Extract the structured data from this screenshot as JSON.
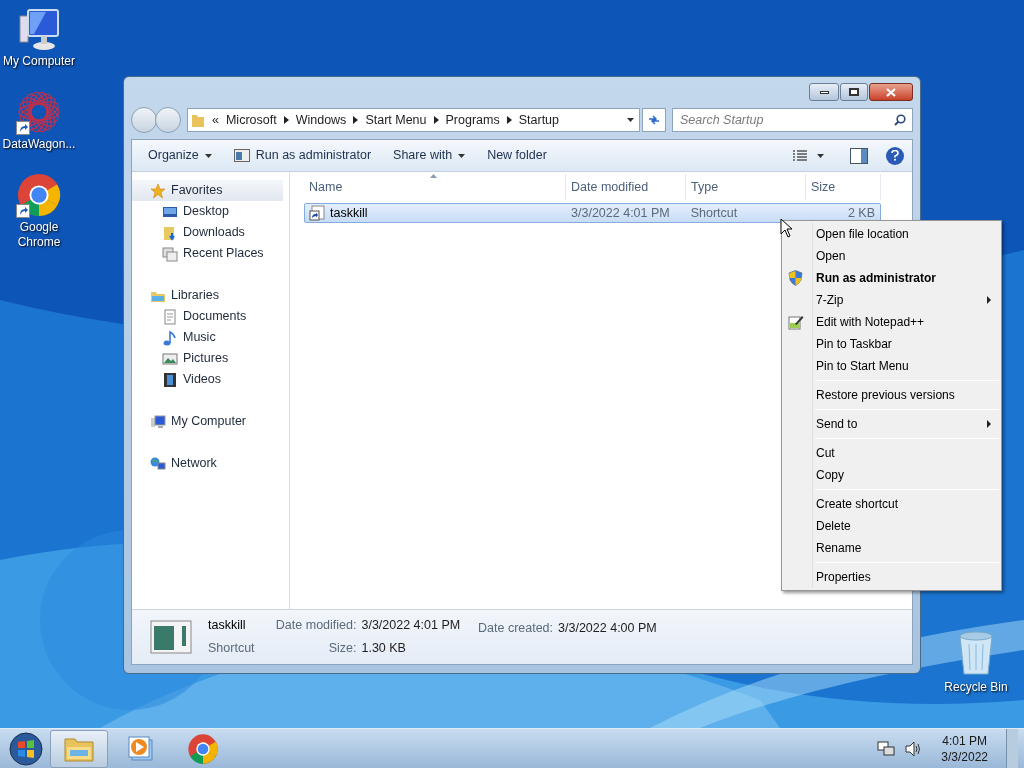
{
  "desktop_icons": [
    {
      "label": "My Computer",
      "kind": "computer"
    },
    {
      "label": "DataWagon...",
      "kind": "datawagon"
    },
    {
      "label": "Google Chrome",
      "kind": "chrome"
    }
  ],
  "recycle_bin": {
    "label": "Recycle Bin"
  },
  "window": {
    "address": {
      "overflow": "«",
      "segments": [
        "Microsoft",
        "Windows",
        "Start Menu",
        "Programs",
        "Startup"
      ]
    },
    "search": {
      "placeholder": "Search Startup"
    },
    "toolbar": [
      {
        "label": "Organize",
        "kind": "menu"
      },
      {
        "label": "Run as administrator",
        "kind": "icon"
      },
      {
        "label": "Share with",
        "kind": "menu"
      },
      {
        "label": "New folder",
        "kind": "plain"
      }
    ],
    "nav": [
      {
        "label": "Favorites",
        "kind": "star",
        "selected": true,
        "children": [
          {
            "label": "Desktop",
            "kind": "desktop",
            "selected": false
          },
          {
            "label": "Downloads",
            "kind": "downloads",
            "selected": false
          },
          {
            "label": "Recent Places",
            "kind": "recent",
            "selected": false
          }
        ]
      },
      {
        "label": "Libraries",
        "kind": "libraries",
        "selected": false,
        "children": [
          {
            "label": "Documents",
            "kind": "documents",
            "selected": false
          },
          {
            "label": "Music",
            "kind": "music",
            "selected": false
          },
          {
            "label": "Pictures",
            "kind": "pictures",
            "selected": false
          },
          {
            "label": "Videos",
            "kind": "videos",
            "selected": false
          }
        ]
      },
      {
        "label": "My Computer",
        "kind": "computer",
        "selected": false
      },
      {
        "label": "Network",
        "kind": "network",
        "selected": false
      }
    ],
    "columns": [
      "Name",
      "Date modified",
      "Type",
      "Size"
    ],
    "rows": [
      {
        "name": "taskkill",
        "date": "3/3/2022 4:01 PM",
        "type": "Shortcut",
        "size": "2 KB",
        "selected": true
      }
    ],
    "details": {
      "name": "taskkill",
      "type": "Shortcut",
      "fields": [
        {
          "label": "Date modified:",
          "value": "3/3/2022 4:01 PM"
        },
        {
          "label": "Size:",
          "value": "1.30 KB"
        },
        {
          "label": "Date created:",
          "value": "3/3/2022 4:00 PM"
        }
      ]
    }
  },
  "context_menu": [
    {
      "kind": "item",
      "label": "Open file location"
    },
    {
      "kind": "item",
      "label": "Open"
    },
    {
      "kind": "shield",
      "label": "Run as administrator",
      "bold": true
    },
    {
      "kind": "item",
      "label": "7-Zip",
      "submenu": true
    },
    {
      "kind": "notepad",
      "label": "Edit with Notepad++"
    },
    {
      "kind": "item",
      "label": "Pin to Taskbar"
    },
    {
      "kind": "item",
      "label": "Pin to Start Menu"
    },
    {
      "kind": "separator"
    },
    {
      "kind": "item",
      "label": "Restore previous versions"
    },
    {
      "kind": "separator"
    },
    {
      "kind": "item",
      "label": "Send to",
      "submenu": true
    },
    {
      "kind": "separator"
    },
    {
      "kind": "item",
      "label": "Cut"
    },
    {
      "kind": "item",
      "label": "Copy"
    },
    {
      "kind": "separator"
    },
    {
      "kind": "item",
      "label": "Create shortcut"
    },
    {
      "kind": "item",
      "label": "Delete"
    },
    {
      "kind": "item",
      "label": "Rename"
    },
    {
      "kind": "separator"
    },
    {
      "kind": "item",
      "label": "Properties"
    }
  ],
  "taskbar": {
    "apps": [
      {
        "kind": "explorer",
        "selected": true
      },
      {
        "kind": "media",
        "selected": false
      },
      {
        "kind": "chrome",
        "selected": false
      }
    ],
    "time": "4:01 PM",
    "date": "3/3/2022"
  }
}
